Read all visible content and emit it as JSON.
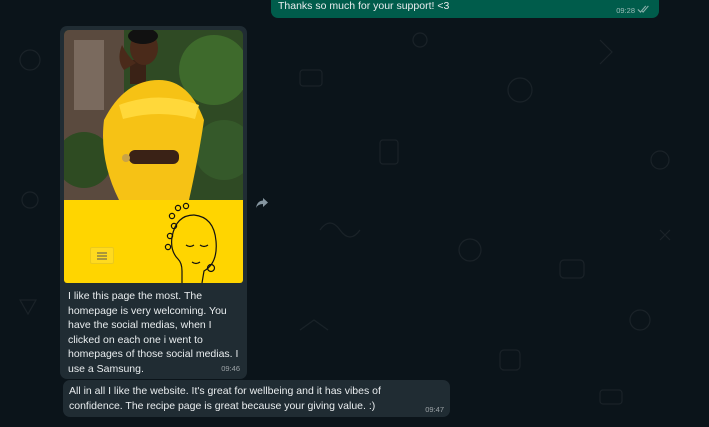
{
  "colors": {
    "background": "#0b141a",
    "outgoing_bubble": "#005c4b",
    "incoming_bubble": "#202c33",
    "text": "#e9edef",
    "read_ticks": "#53bdeb",
    "banner_yellow": "#ffd500"
  },
  "messages": [
    {
      "direction": "outgoing",
      "text": "Thanks so much for your support! <3",
      "time": "09:28",
      "status_icon": "double-check-icon"
    },
    {
      "direction": "incoming",
      "type": "image",
      "image": "website-screenshot-woman-yellow-dress",
      "caption": "I like this page the most.  The homepage is very welcoming.  You have the social medias, when I clicked on each one i went to homepages of those social medias.  I use a Samsung.",
      "time": "09:46",
      "forward_icon": "forward-icon"
    },
    {
      "direction": "incoming",
      "type": "text",
      "text": "All in all I like the website.  It's great for wellbeing and it has vibes of confidence.  The recipe page is great because your giving value. :)",
      "time": "09:47"
    }
  ]
}
